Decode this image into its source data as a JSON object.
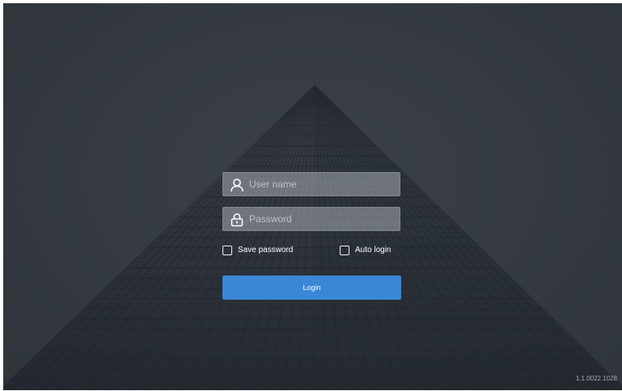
{
  "login": {
    "username_placeholder": "User name",
    "password_placeholder": "Password",
    "save_password_label": "Save password",
    "auto_login_label": "Auto login",
    "login_button_label": "Login"
  },
  "icons": {
    "username": "user-icon",
    "password": "lock-icon"
  },
  "version": "1.1.0022.1028",
  "colors": {
    "background": "#353a42",
    "field_fill": "#ced2d8",
    "button": "#3987d6",
    "text": "#ffffff",
    "version_text": "#a9adb3"
  }
}
